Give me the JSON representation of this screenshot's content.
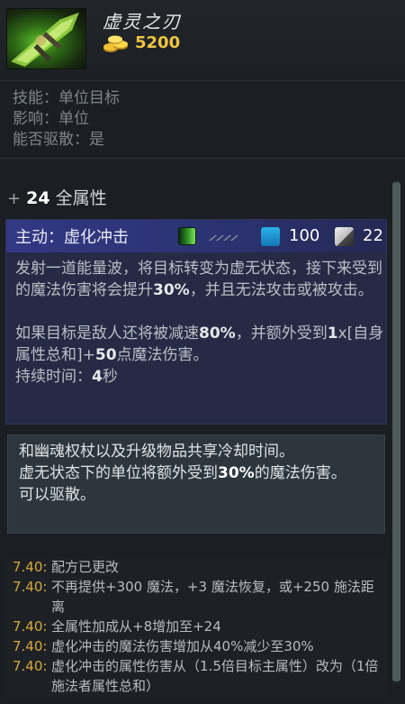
{
  "item": {
    "name": "虚灵之刃",
    "cost": "5200",
    "icon": "ethereal-blade-icon",
    "gold_icon": "gold-coins-icon"
  },
  "meta": {
    "ability": "技能：单位目标",
    "affects": "影响：单位",
    "dispellable": "能否驱散：是"
  },
  "attribute": {
    "plus": "+",
    "value": "24",
    "label": "全属性"
  },
  "active": {
    "title": "主动：虚化冲击",
    "mana_cost": "100",
    "cooldown": "22",
    "icons": [
      "mana-bar-icon",
      "wind-icon",
      "mana-icon",
      "cooldown-icon"
    ],
    "desc1_a": "发射一道能量波，将目标转变为虚无状态，接下来受到的魔法伤害将会提升",
    "desc1_b": "30%",
    "desc1_c": "，并且无法攻击或被攻击。",
    "desc2_a": "如果目标是敌人还将被减速",
    "desc2_b": "80%",
    "desc2_c": "，并额外受到",
    "desc2_d": "1",
    "desc2_e": "x[自身属性总和]+",
    "desc2_f": "50",
    "desc2_g": "点魔法伤害。",
    "duration_a": "持续时间：",
    "duration_b": "4",
    "duration_c": "秒"
  },
  "notes": {
    "line1": "和幽魂权杖以及升级物品共享冷却时间。",
    "line2_a": "虚无状态下的单位将额外受到",
    "line2_b": "30%",
    "line2_c": "的魔法伤害。",
    "line3": "可以驱散。"
  },
  "changes": [
    {
      "version": "7.40:",
      "text": "配方已更改"
    },
    {
      "version": "7.40:",
      "text": "不再提供+300 魔法，+3 魔法恢复，或+250 施法距离"
    },
    {
      "version": "7.40:",
      "text": "全属性加成从+8增加至+24"
    },
    {
      "version": "7.40:",
      "text": "虚化冲击的魔法伤害增加从40%减少至30%"
    },
    {
      "version": "7.40:",
      "text": "虚化冲击的属性伤害从（1.5倍目标主属性）改为（1倍施法者属性总和）"
    }
  ]
}
